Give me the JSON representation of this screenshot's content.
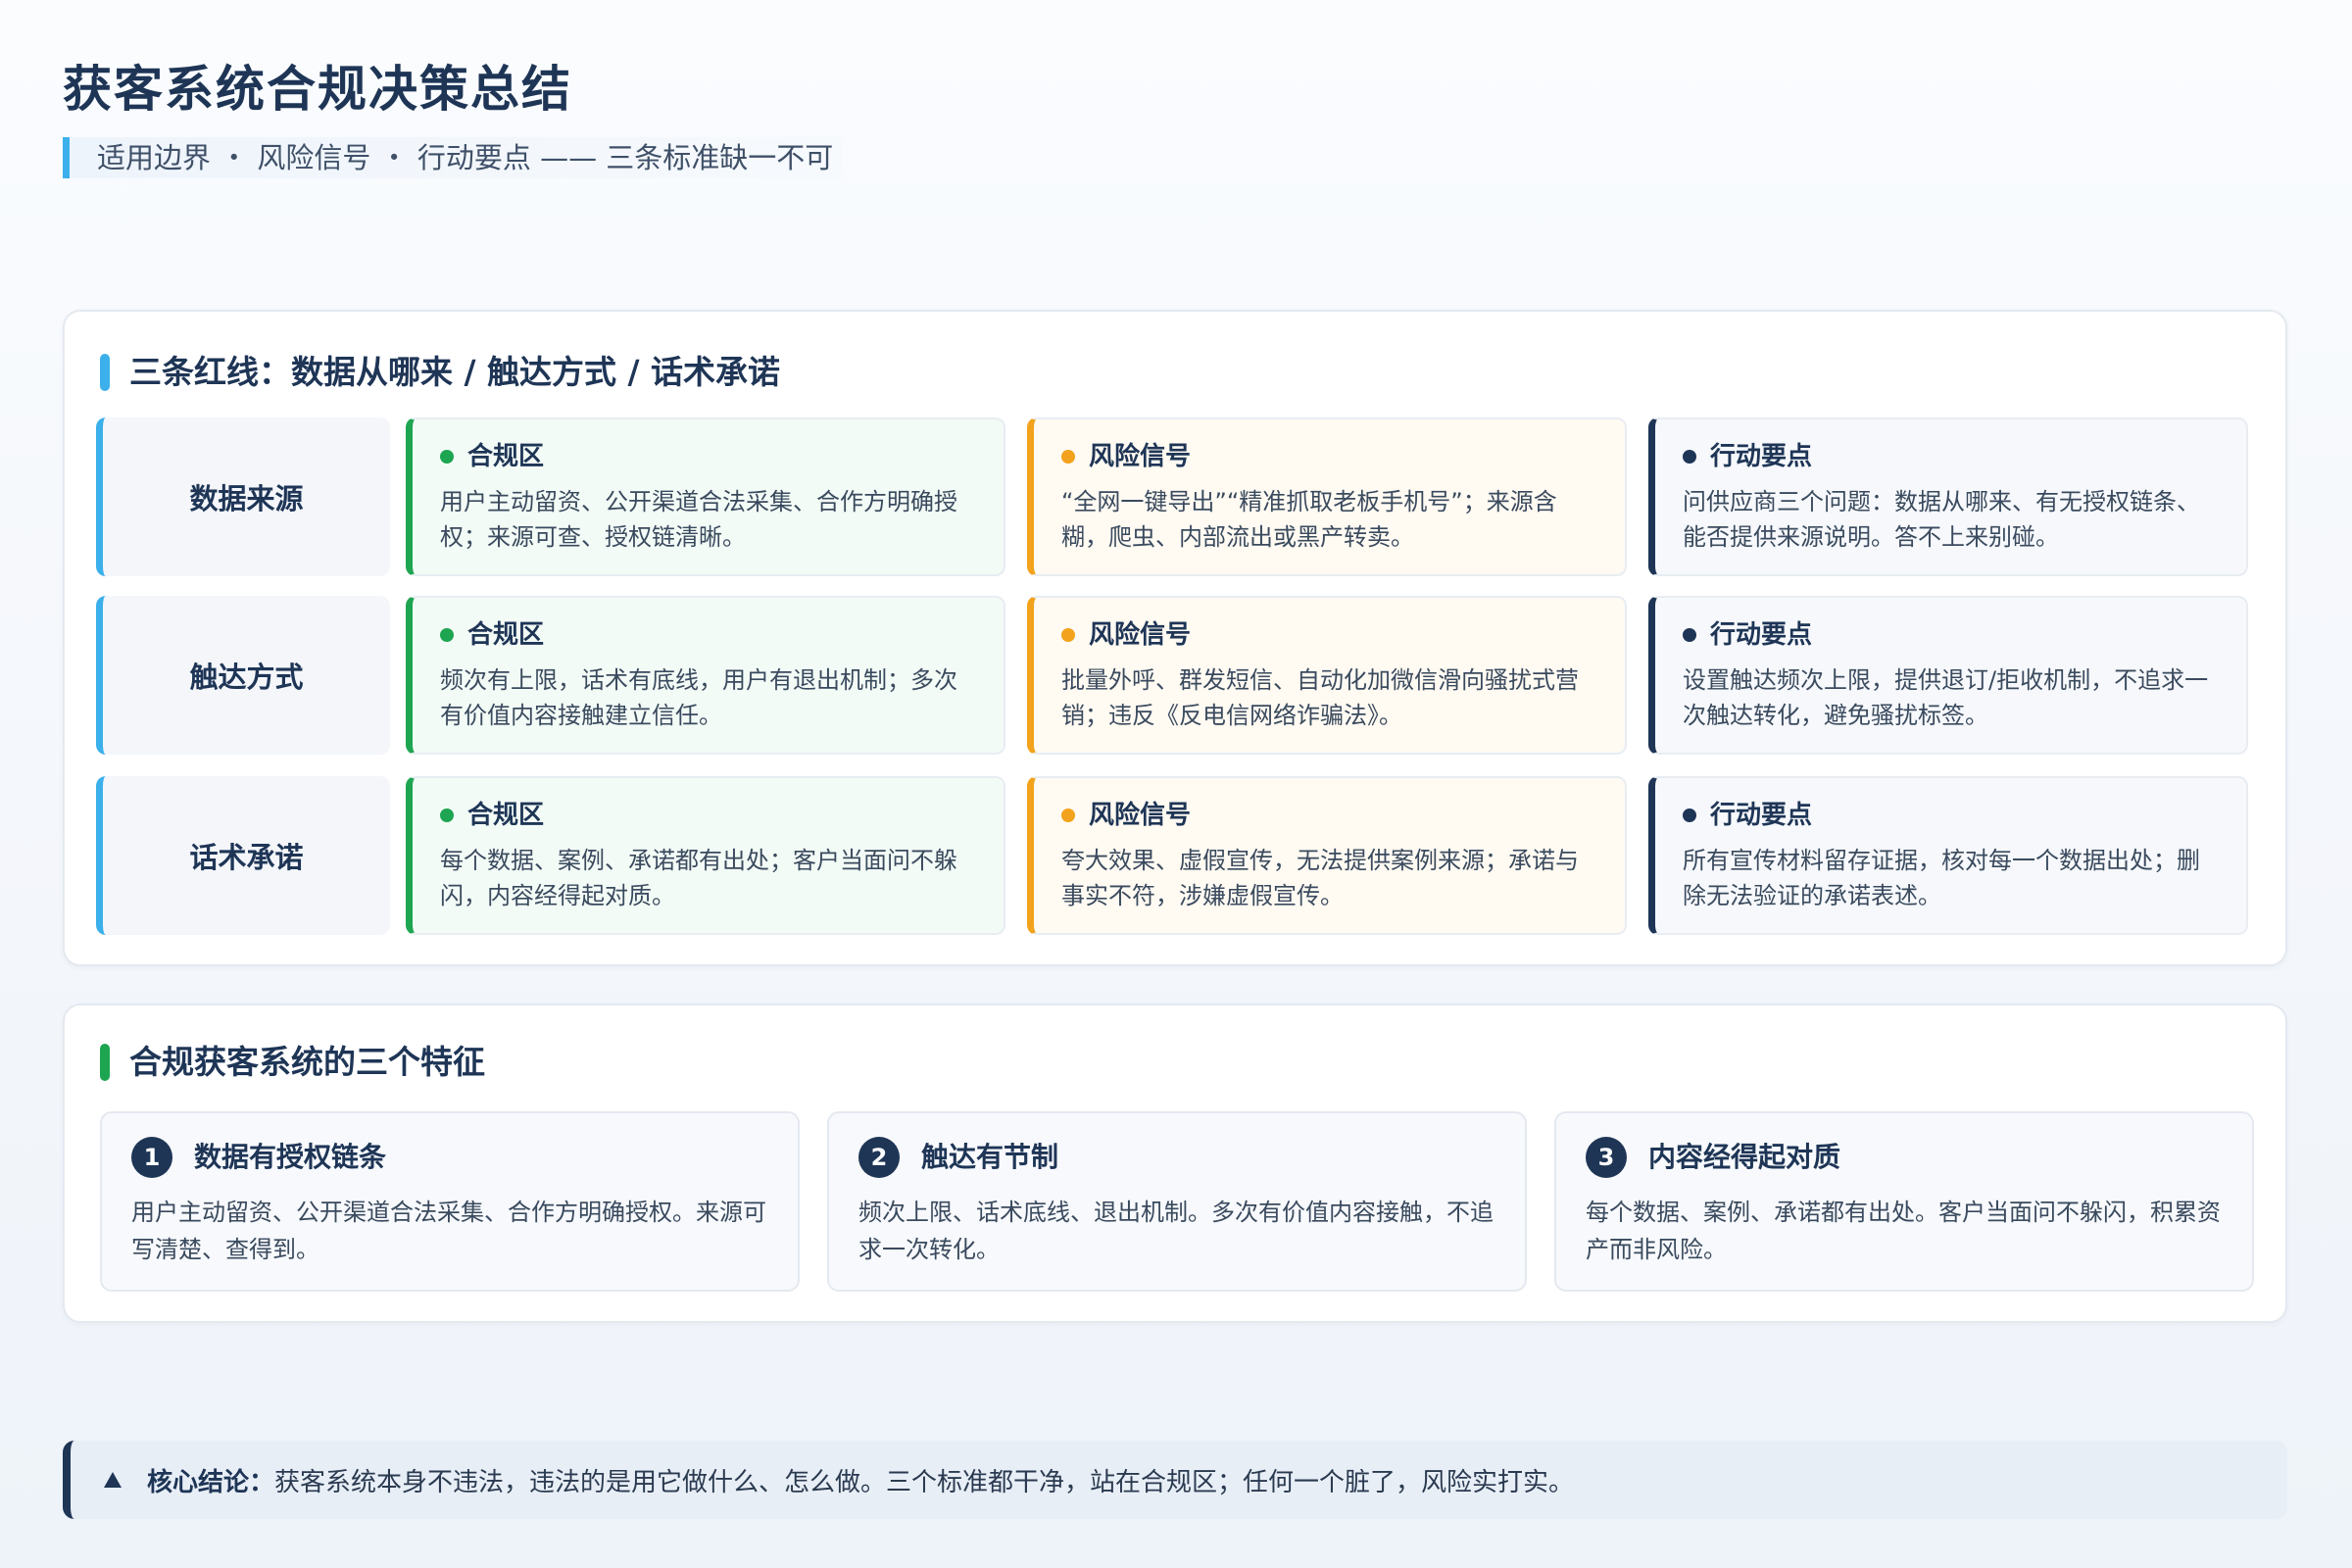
{
  "header": {
    "title": "获客系统合规决策总结",
    "subtitle": "适用边界 ・ 风险信号 ・ 行动要点 —— 三条标准缺一不可"
  },
  "redlines": {
    "title": "三条红线：数据从哪来 / 触达方式 / 话术承诺",
    "rows": [
      {
        "label": "数据来源",
        "ok": {
          "head": "合规区",
          "body": "用户主动留资、公开渠道合法采集、合作方明确授权；来源可查、授权链清晰。"
        },
        "risk": {
          "head": "风险信号",
          "body": "“全网一键导出”“精准抓取老板手机号”；来源含糊，爬虫、内部流出或黑产转卖。"
        },
        "act": {
          "head": "行动要点",
          "body": "问供应商三个问题：数据从哪来、有无授权链条、能否提供来源说明。答不上来别碰。"
        }
      },
      {
        "label": "触达方式",
        "ok": {
          "head": "合规区",
          "body": "频次有上限，话术有底线，用户有退出机制；多次有价值内容接触建立信任。"
        },
        "risk": {
          "head": "风险信号",
          "body": "批量外呼、群发短信、自动化加微信滑向骚扰式营销；违反《反电信网络诈骗法》。"
        },
        "act": {
          "head": "行动要点",
          "body": "设置触达频次上限，提供退订/拒收机制，不追求一次触达转化，避免骚扰标签。"
        }
      },
      {
        "label": "话术承诺",
        "ok": {
          "head": "合规区",
          "body": "每个数据、案例、承诺都有出处；客户当面问不躲闪，内容经得起对质。"
        },
        "risk": {
          "head": "风险信号",
          "body": "夸大效果、虚假宣传，无法提供案例来源；承诺与事实不符，涉嫌虚假宣传。"
        },
        "act": {
          "head": "行动要点",
          "body": "所有宣传材料留存证据，核对每一个数据出处；删除无法验证的承诺表述。"
        }
      }
    ]
  },
  "features": {
    "title": "合规获客系统的三个特征",
    "items": [
      {
        "num": "1",
        "title": "数据有授权链条",
        "body": "用户主动留资、公开渠道合法采集、合作方明确授权。来源可写清楚、查得到。"
      },
      {
        "num": "2",
        "title": "触达有节制",
        "body": "频次上限、话术底线、退出机制。多次有价值内容接触，不追求一次转化。"
      },
      {
        "num": "3",
        "title": "内容经得起对质",
        "body": "每个数据、案例、承诺都有出处。客户当面问不躲闪，积累资产而非风险。"
      }
    ]
  },
  "conclusion": {
    "label": "核心结论：",
    "text": "获客系统本身不违法，违法的是用它做什么、怎么做。三个标准都干净，站在合规区；任何一个脏了，风险实打实。"
  },
  "colors": {
    "primary": "#1e3556",
    "accent_blue": "#3bb0ea",
    "ok_green": "#1ea551",
    "risk_orange": "#f2a21c"
  }
}
